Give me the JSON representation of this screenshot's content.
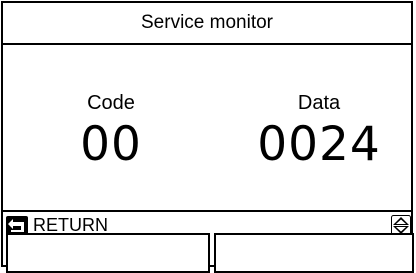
{
  "header": {
    "title": "Service monitor"
  },
  "monitor": {
    "code_label": "Code",
    "code_value": "00",
    "data_label": "Data",
    "data_value": "0024"
  },
  "footer": {
    "return_label": "RETURN",
    "return_icon": "return-arrow-icon",
    "scroll_icon": "up-down-arrows-icon"
  }
}
